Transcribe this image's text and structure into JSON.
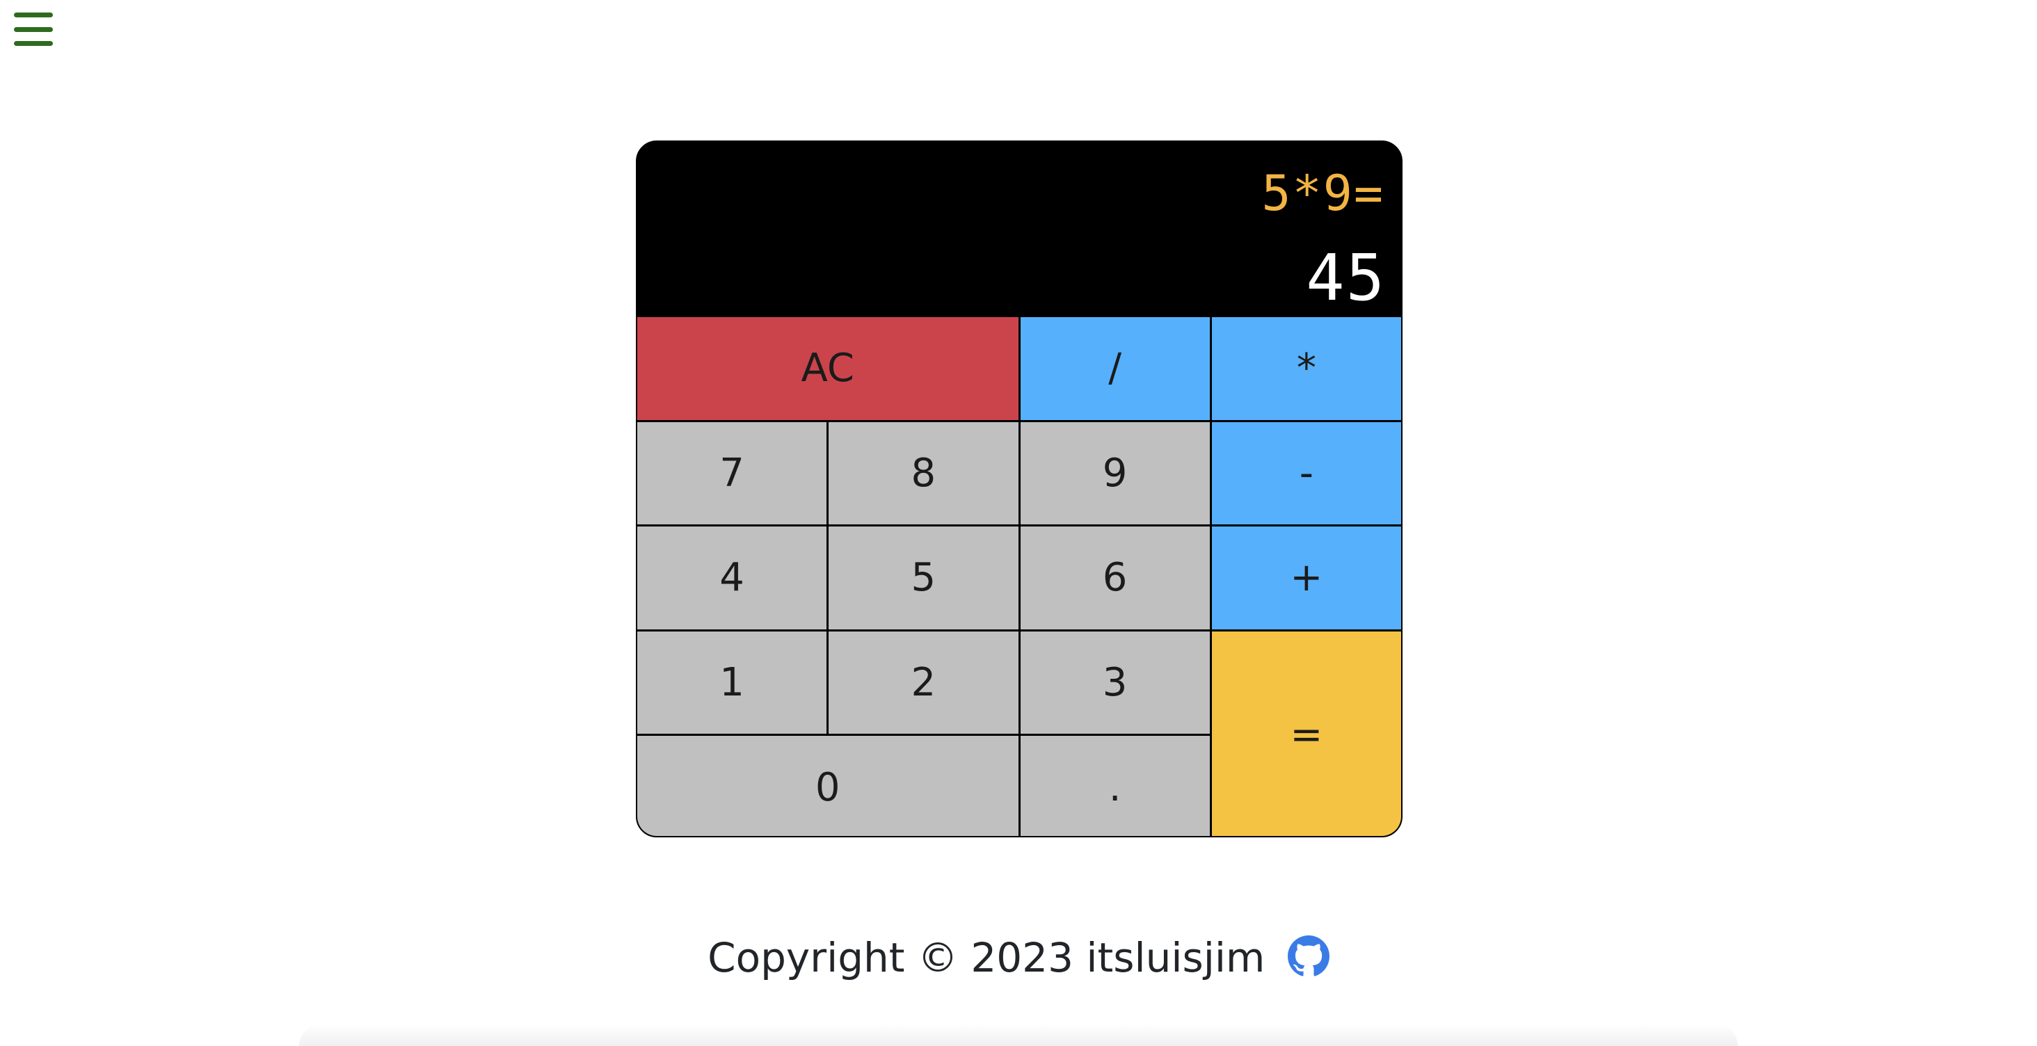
{
  "menu": {
    "icon": "hamburger-menu-icon",
    "color": "#2f6b1f"
  },
  "display": {
    "formula": "5*9=",
    "result": "45",
    "formula_color": "#f2b443",
    "result_color": "#ffffff"
  },
  "keys": {
    "clear": "AC",
    "divide": "/",
    "multiply": "*",
    "seven": "7",
    "eight": "8",
    "nine": "9",
    "subtract": "-",
    "four": "4",
    "five": "5",
    "six": "6",
    "add": "+",
    "one": "1",
    "two": "2",
    "three": "3",
    "equals": "=",
    "zero": "0",
    "decimal": "."
  },
  "colors": {
    "clear": "#cc444b",
    "operator": "#56b0fb",
    "equals": "#f5c343",
    "number": "#c0c0c0"
  },
  "footer": {
    "text": "Copyright © 2023 itsluisjim",
    "icon": "github-icon",
    "icon_color": "#3b7be6"
  }
}
